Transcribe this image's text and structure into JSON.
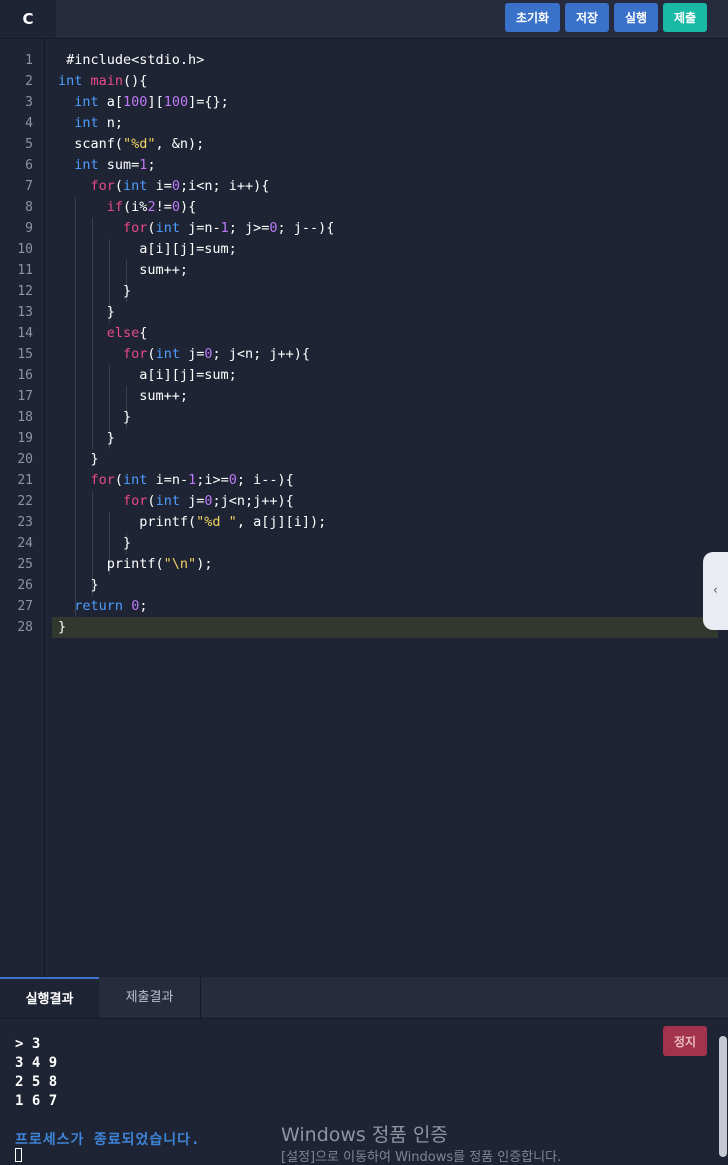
{
  "toolbar": {
    "language": "C",
    "reset_label": "초기화",
    "save_label": "저장",
    "run_label": "실행",
    "submit_label": "제출"
  },
  "editor": {
    "line_numbers": [
      "1",
      "2",
      "3",
      "4",
      "5",
      "6",
      "7",
      "8",
      "9",
      "10",
      "11",
      "12",
      "13",
      "14",
      "15",
      "16",
      "17",
      "18",
      "19",
      "20",
      "21",
      "22",
      "23",
      "24",
      "25",
      "26",
      "27",
      "28"
    ],
    "code_lines": [
      " #include<stdio.h>",
      "int main(){",
      "  int a[100][100]={};",
      "  int n;",
      "  scanf(\"%d\", &n);",
      "  int sum=1;",
      "    for(int i=0;i<n; i++){",
      "      if(i%2!=0){",
      "        for(int j=n-1; j>=0; j--){",
      "          a[i][j]=sum;",
      "          sum++;",
      "        }",
      "      }",
      "      else{",
      "        for(int j=0; j<n; j++){",
      "          a[i][j]=sum;",
      "          sum++;",
      "        }",
      "      }",
      "    }",
      "    for(int i=n-1;i>=0; i--){",
      "        for(int j=0;j<n;j++){",
      "          printf(\"%d \", a[j][i]);",
      "        }",
      "      printf(\"\\n\");",
      "    }",
      "  return 0;",
      "}"
    ],
    "collapse_icon": "chevron-left-icon"
  },
  "result_tabs": {
    "run_result": "실행결과",
    "submit_result": "제출결과"
  },
  "console": {
    "output_lines": [
      "> 3",
      "3 4 9",
      "2 5 8",
      "1 6 7"
    ],
    "status": "프로세스가 종료되었습니다.",
    "stop_label": "정지"
  },
  "os_overlay": {
    "title": "Windows 정품 인증",
    "subtitle": "[설정]으로 이동하여 Windows를 정품 인증합니다."
  }
}
